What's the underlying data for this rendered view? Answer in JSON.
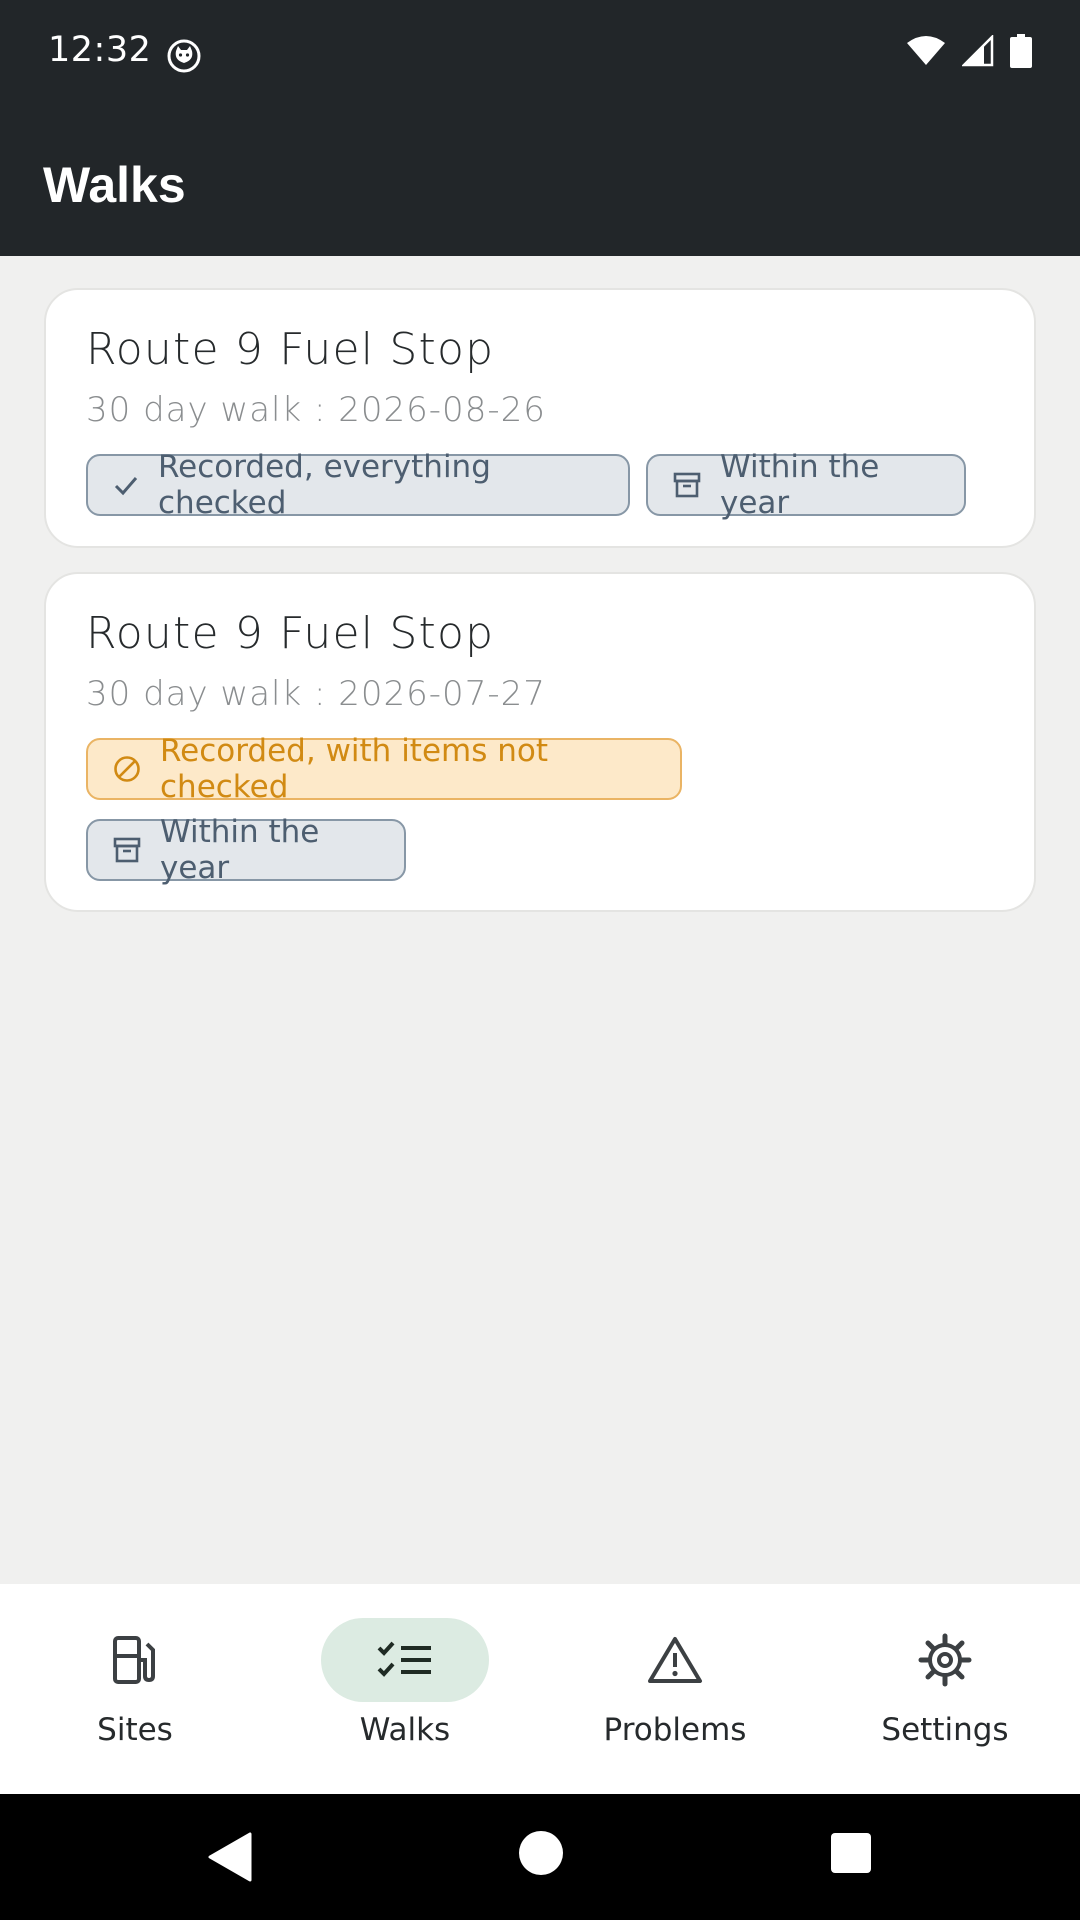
{
  "status_bar": {
    "time": "12:32"
  },
  "app_bar": {
    "title": "Walks"
  },
  "walks": [
    {
      "title": "Route 9 Fuel Stop",
      "subtitle": "30 day walk : 2026-08-26",
      "status_chip": "Recorded, everything checked",
      "period_chip": "Within the year"
    },
    {
      "title": "Route 9 Fuel Stop",
      "subtitle": "30 day walk : 2026-07-27",
      "status_chip": "Recorded, with items not checked",
      "period_chip": "Within the year"
    }
  ],
  "bottom_nav": {
    "items": [
      {
        "label": "Sites",
        "icon": "fuel-pump-icon"
      },
      {
        "label": "Walks",
        "icon": "checklist-icon",
        "active": true
      },
      {
        "label": "Problems",
        "icon": "warning-icon"
      },
      {
        "label": "Settings",
        "icon": "gear-icon"
      }
    ]
  },
  "colors": {
    "app_bar": "#222629",
    "chip_gray_text": "#4d5e70",
    "chip_orange_text": "#d18a13",
    "nav_active": "#dcebe2"
  }
}
